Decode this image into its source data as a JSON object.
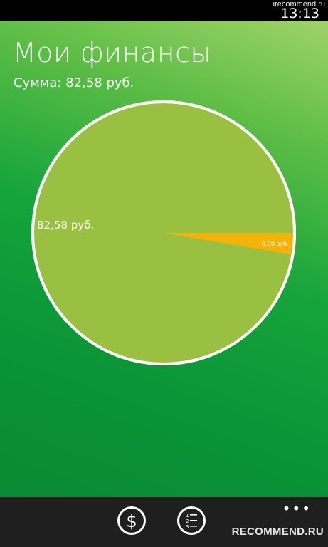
{
  "status": {
    "clock": "13:13",
    "watermark": "irecommend.ru"
  },
  "header": {
    "title": "Мои финансы",
    "sum_label": "Сумма: 82,58 руб."
  },
  "chart_data": {
    "type": "pie",
    "title": "",
    "slices": [
      {
        "label": "82,58 руб.",
        "value": 82.58,
        "color": "#99c041"
      },
      {
        "label": "0,00 руб.",
        "value": 0.0,
        "color": "#f2b30d"
      }
    ]
  },
  "app_bar": {
    "more_label": "•••",
    "buttons": [
      {
        "name": "dollar-button",
        "icon": "dollar-icon"
      },
      {
        "name": "list-button",
        "icon": "numbered-list-icon"
      }
    ],
    "watermark": "RECOMMEND.RU"
  },
  "colors": {
    "accent_green": "#0a9337",
    "pie_main": "#99c041",
    "pie_slice": "#f2b30d",
    "app_bar": "#1f1f1f"
  }
}
